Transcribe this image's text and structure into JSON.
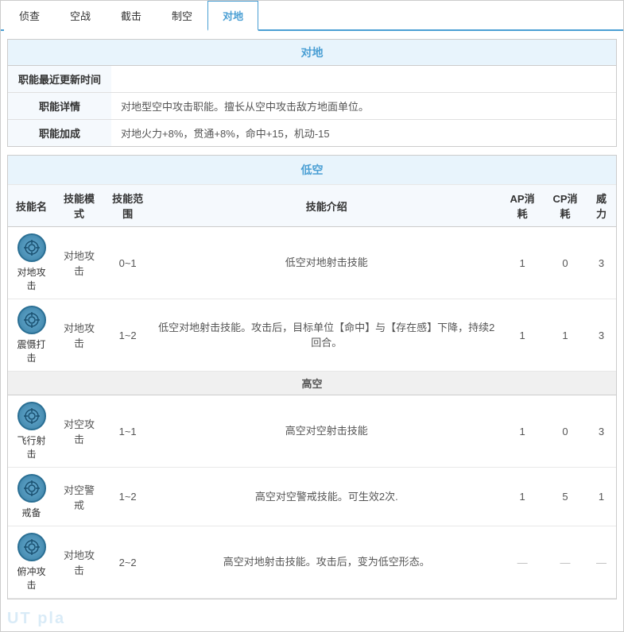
{
  "nav": {
    "tabs": [
      {
        "label": "侦查",
        "active": false
      },
      {
        "label": "空战",
        "active": false
      },
      {
        "label": "截击",
        "active": false
      },
      {
        "label": "制空",
        "active": false
      },
      {
        "label": "对地",
        "active": true
      }
    ]
  },
  "main_section": {
    "title": "对地",
    "rows": [
      {
        "label": "职能最近更新时间",
        "value": ""
      },
      {
        "label": "职能详情",
        "value": "对地型空中攻击职能。擅长从空中攻击敌方地面单位。"
      },
      {
        "label": "职能加成",
        "value": "对地火力+8%，贯通+8%，命中+15，机动-15"
      }
    ]
  },
  "skills_section": {
    "low_alt_header": "低空",
    "high_alt_header": "高空",
    "table_headers": [
      "技能名",
      "技能模式",
      "技能范围",
      "技能介绍",
      "AP消耗",
      "CP消耗",
      "威力"
    ],
    "low_skills": [
      {
        "name": "对地攻击",
        "mode": "对地攻击",
        "range": "0~1",
        "desc": "低空对地射击技能",
        "ap": "1",
        "cp": "0",
        "power": "3"
      },
      {
        "name": "震慑打击",
        "mode": "对地攻击",
        "range": "1~2",
        "desc": "低空对地射击技能。攻击后，目标单位【命中】与【存在感】下降，持续2回合。",
        "ap": "1",
        "cp": "1",
        "power": "3"
      }
    ],
    "high_skills": [
      {
        "name": "飞行射击",
        "mode": "对空攻击",
        "range": "1~1",
        "desc": "高空对空射击技能",
        "ap": "1",
        "cp": "0",
        "power": "3"
      },
      {
        "name": "戒备",
        "mode": "对空警戒",
        "range": "1~2",
        "desc": "高空对空警戒技能。可生效2次.",
        "ap": "1",
        "cp": "5",
        "power": "1"
      },
      {
        "name": "俯冲攻击",
        "mode": "对地攻击",
        "range": "2~2",
        "desc": "高空对地射击技能。攻击后，变为低空形态。",
        "ap": "",
        "cp": "",
        "power": ""
      }
    ]
  },
  "watermark": "UT pla"
}
